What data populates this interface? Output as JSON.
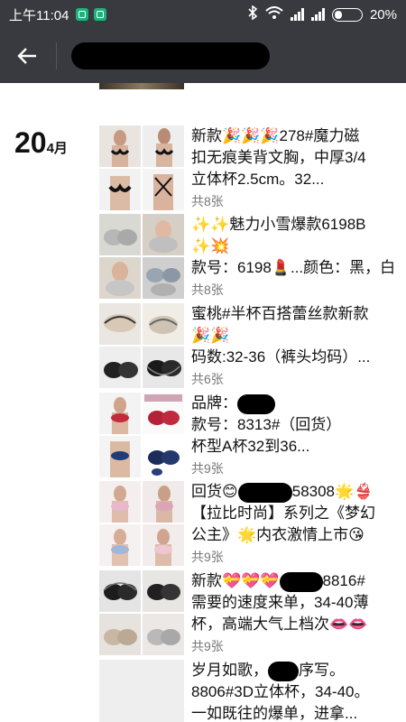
{
  "status_bar": {
    "time": "上午11:04",
    "battery": "20%"
  },
  "date": {
    "day": "20",
    "month": "4月"
  },
  "posts": [
    {
      "lines": [
        "新款🎉🎉🎉278#魔力磁",
        "扣无痕美背文胸，中厚3/4",
        "立体杯2.5cm。32..."
      ],
      "count": "共8张"
    },
    {
      "lines": [
        "✨✨魅力小雪爆款6198B",
        "✨💥",
        "款号：6198💄...颜色：黑，白"
      ],
      "count": "共8张"
    },
    {
      "lines": [
        "蜜桃#半杯百搭蕾丝款新款",
        "🎉🎉",
        "码数:32-36（裤头均码）..."
      ],
      "count": "共6张"
    },
    {
      "lines": [
        "品牌：",
        "款号：8313#（回货）",
        "杯型A杯32到36..."
      ],
      "count": "共9张"
    },
    {
      "lines_pre": "回货😊",
      "lines_post": "58308🌟👙",
      "lines": [
        "【拉比时尚】系列之《梦幻",
        "公主》🌟内衣激情上市😘"
      ],
      "count": "共9张"
    },
    {
      "lines_pre": "新款💝💝💝",
      "lines_post": "8816#",
      "lines": [
        "需要的速度来单，34-40薄",
        "杯，高端大气上档次👄👄"
      ],
      "count": "共9张"
    },
    {
      "lines_pre": "岁月如歌，",
      "lines_post": "序写。",
      "lines": [
        "8806#3D立体杯，34-40。",
        "一如既往的爆单，进拿..."
      ],
      "count": ""
    }
  ]
}
